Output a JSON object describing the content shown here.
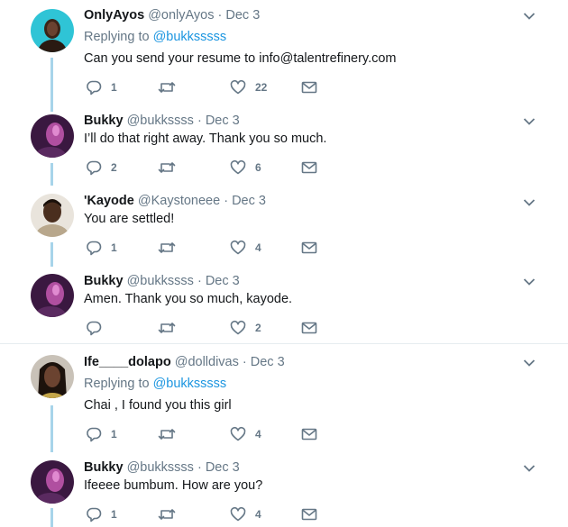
{
  "tweets": [
    {
      "name": "OnlyAyos",
      "handle": "@onlyAyos",
      "date": "Dec 3",
      "replying_to_prefix": "Replying to",
      "replying_to_handle": "@bukksssss",
      "text": "Can you send your resume to info@talentrefinery.com",
      "reply_count": "1",
      "retweet_count": "",
      "like_count": "22",
      "colors": {
        "avatar_bg": "#2fc4d6",
        "avatar_figure": "#3b2418"
      }
    },
    {
      "name": "Bukky",
      "handle": "@bukkssss",
      "date": "Dec 3",
      "text": "I’ll do that right away. Thank you so much.",
      "reply_count": "2",
      "retweet_count": "",
      "like_count": "6",
      "colors": {
        "avatar_bg": "#3a1840",
        "avatar_figure": "#b04fa0"
      }
    },
    {
      "name": "'Kayode",
      "handle": "@Kaystoneee",
      "date": "Dec 3",
      "text": "You are settled!",
      "reply_count": "1",
      "retweet_count": "",
      "like_count": "4",
      "colors": {
        "avatar_bg": "#e9e4dc",
        "avatar_figure": "#2a1a12"
      }
    },
    {
      "name": "Bukky",
      "handle": "@bukkssss",
      "date": "Dec 3",
      "text": "Amen. Thank you so much, kayode.",
      "reply_count": "",
      "retweet_count": "",
      "like_count": "2",
      "colors": {
        "avatar_bg": "#3a1840",
        "avatar_figure": "#b04fa0"
      }
    },
    {
      "name": "Ife____dolapo",
      "handle": "@dolldivas",
      "date": "Dec 3",
      "replying_to_prefix": "Replying to",
      "replying_to_handle": "@bukksssss",
      "text": "Chai , I found you this girl",
      "reply_count": "1",
      "retweet_count": "",
      "like_count": "4",
      "colors": {
        "avatar_bg": "#c9c2b8",
        "avatar_figure": "#2b1a10"
      }
    },
    {
      "name": "Bukky",
      "handle": "@bukkssss",
      "date": "Dec 3",
      "text": "Ifeeee bumbum. How are you?",
      "reply_count": "1",
      "retweet_count": "",
      "like_count": "4",
      "colors": {
        "avatar_bg": "#3a1840",
        "avatar_figure": "#b04fa0"
      }
    }
  ],
  "separator": " · ",
  "icons": {
    "reply": "reply-icon",
    "retweet": "retweet-icon",
    "like": "heart-icon",
    "dm": "envelope-icon",
    "more": "chevron-down-icon"
  },
  "colors": {
    "icon": "#657786",
    "link": "#1b95e0",
    "thread_line": "#a7d4ea",
    "divider": "#e6ecf0"
  }
}
